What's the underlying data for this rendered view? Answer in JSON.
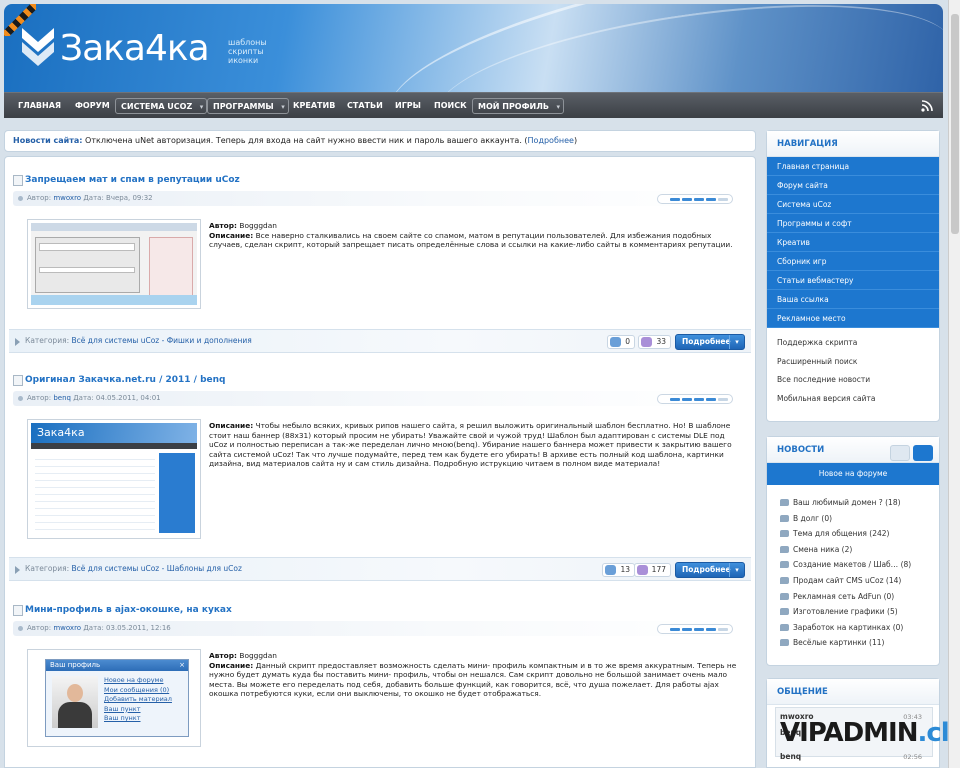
{
  "logo": {
    "text": "Зака4ка",
    "tags": [
      "шаблоны",
      "скрипты",
      "иконки"
    ]
  },
  "nav": {
    "items": [
      {
        "label": "ГЛАВНАЯ",
        "dropdown": false
      },
      {
        "label": "ФОРУМ",
        "dropdown": false
      },
      {
        "label": "СИСТЕМА UCOZ",
        "dropdown": true
      },
      {
        "label": "ПРОГРАММЫ",
        "dropdown": true
      },
      {
        "label": "КРЕАТИВ",
        "dropdown": false
      },
      {
        "label": "СТАТЬИ",
        "dropdown": false
      },
      {
        "label": "ИГРЫ",
        "dropdown": false
      },
      {
        "label": "ПОИСК",
        "dropdown": false
      },
      {
        "label": "МОЙ ПРОФИЛЬ",
        "dropdown": true
      }
    ]
  },
  "notice": {
    "label": "Новости сайта:",
    "text": "Отключена uNet авторизация. Теперь для входа на сайт нужно ввести ник и пароль вашего аккаунта. (",
    "link": "Подробнее",
    "close": ")"
  },
  "entries": [
    {
      "title": "Запрещаем мат и спам в репутации uCoz",
      "meta_author_label": "Автор:",
      "meta_author": "mwoxro",
      "meta_date_label": "Дата:",
      "meta_date": "Вчера, 09:32",
      "author_label": "Автор:",
      "author": "Bogggdan",
      "desc_label": "Описание:",
      "desc": "Все наверно сталкивались на своем сайте со спамом, матом в репутации пользователей. Для избежания подобных случаев, сделан скрипт, который запрещает писать определённые слова и ссылки на какие-либо сайты в комментариях репутации.",
      "category_label": "Категория:",
      "category": "Всё для системы uCoz - Фишки и дополнения",
      "comments": "0",
      "views": "33",
      "more": "Подробнее"
    },
    {
      "title": "Оригинал Закачка.net.ru / 2011 / benq",
      "meta_author_label": "Автор:",
      "meta_author": "benq",
      "meta_date_label": "Дата:",
      "meta_date": "04.05.2011, 04:01",
      "desc_label": "Описание:",
      "desc": "Чтобы небыло всяких, кривых рипов нашего сайта, я решил выложить оригинальный шаблон бесплатно. Но! В шаблоне стоит наш баннер (88x31) который просим не убирать! Уважайте свой и чужой труд! Шаблон был адаптирован с системы DLE под uCoz и полностью переписан а так-же переделан лично мною(benq). Убирание нашего баннера может привести к закрытию вашего сайта системой uCoz! Так что лучше подумайте, перед тем как будете его убирать! В архиве есть полный код шаблона, картинки дизайна, вид материалов сайта ну и сам стиль дизайна. Подробную иструкцию читаем в полном виде материала!",
      "thumb_logo": "Зака4ка",
      "category_label": "Категория:",
      "category": "Всё для системы uCoz - Шаблоны для uCoz",
      "comments": "13",
      "views": "177",
      "more": "Подробнее"
    },
    {
      "title": "Мини-профиль в ajax-окошке, на куках",
      "meta_author_label": "Автор:",
      "meta_author": "mwoxro",
      "meta_date_label": "Дата:",
      "meta_date": "03.05.2011, 12:16",
      "author_label": "Автор:",
      "author": "Bogggdan",
      "desc_label": "Описание:",
      "desc": "Данный скрипт предоставляет возможность сделать мини- профиль компактным и в то же время аккуратным. Теперь не нужно будет думать куда бы поставить мини- профиль, чтобы он нешался. Сам скрипт довольно не большой занимает очень мало места. Вы можете его переделать под себя, добавить больше функций, как говорится, всё, что душа пожелает. Для работы ajax окошка потребуются куки, если они выключены, то окошко не будет отображаться.",
      "popup_title": "Ваш профиль",
      "popup_links": [
        "Новое на форуме",
        "Мои сообщения (0)",
        "Добавить материал",
        "Ваш пункт",
        "Ваш пункт"
      ]
    }
  ],
  "sidebar": {
    "nav_title": "НАВИГАЦИЯ",
    "nav_blue": [
      "Главная страница",
      "Форум сайта",
      "Система uCoz",
      "Программы и софт",
      "Креатив",
      "Сборник игр",
      "Статьи вебмастеру",
      "Ваша ссылка",
      "Рекламное место"
    ],
    "nav_plain": [
      "Поддержка скрипта",
      "Расширенный поиск",
      "Все последние новости",
      "Мобильная версия сайта"
    ],
    "news_title": "НОВОСТИ",
    "news_sub": "Новое на форуме",
    "forum_items": [
      "Ваш любимый домен ? (18)",
      "В долг (0)",
      "Тема для общения (242)",
      "Смена ника (2)",
      "Создание макетов / Шаб… (8)",
      "Продам сайт CMS uCoz (14)",
      "Рекламная сеть AdFun (0)",
      "Изготовление графики (5)",
      "Заработок на картинках (0)",
      "Весёлые картинки (11)"
    ],
    "chat_title": "ОБЩЕНИЕ",
    "chat": [
      {
        "user": "mwoxro",
        "time": "03:43"
      },
      {
        "user": "benq",
        "time": ""
      },
      {
        "user": "benq",
        "time": "02:56"
      }
    ]
  },
  "watermark": {
    "main": "VIPADMIN",
    "suffix": ".club"
  },
  "colors": {
    "accent": "#1d77cf",
    "link": "#2372c4",
    "nav_bg": "#3b3f45"
  }
}
